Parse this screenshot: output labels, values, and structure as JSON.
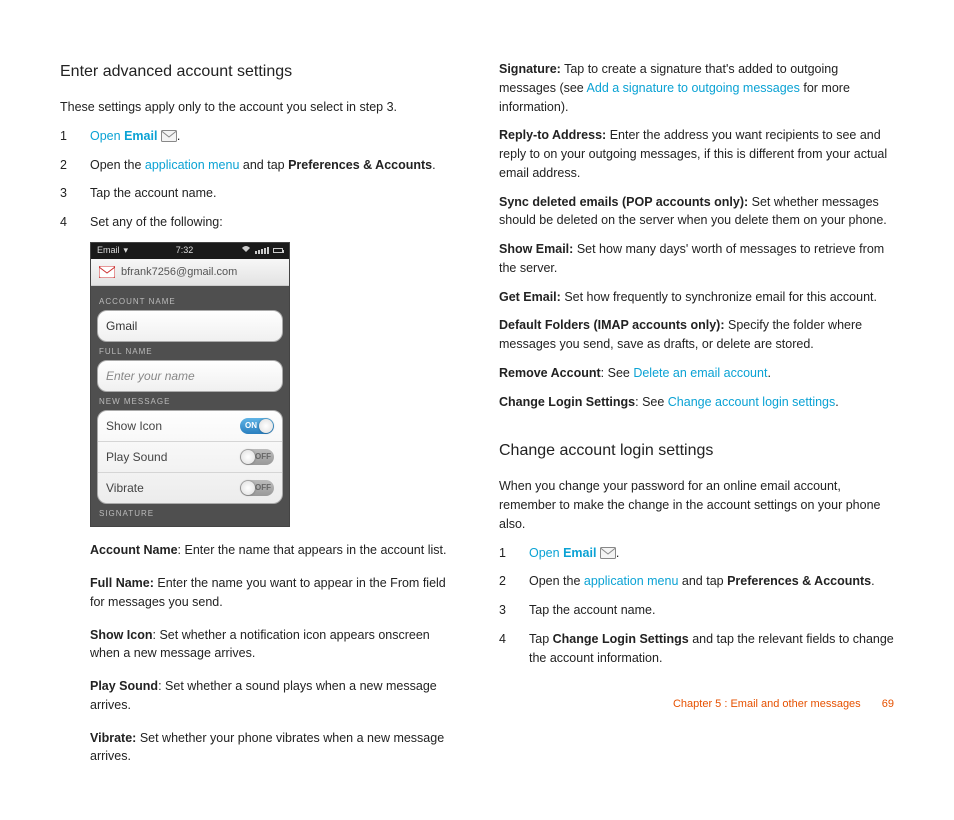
{
  "col1": {
    "heading": "Enter advanced account settings",
    "intro": "These settings apply only to the account you select in step 3.",
    "steps": [
      {
        "num": "1",
        "parts": [
          {
            "t": "link",
            "v": "Open "
          },
          {
            "t": "linkbold",
            "v": "Email"
          },
          {
            "t": "text",
            "v": " "
          },
          {
            "t": "icon"
          },
          {
            "t": "text",
            "v": "."
          }
        ]
      },
      {
        "num": "2",
        "parts": [
          {
            "t": "text",
            "v": "Open the "
          },
          {
            "t": "link",
            "v": "application menu"
          },
          {
            "t": "text",
            "v": " and tap "
          },
          {
            "t": "bold",
            "v": "Preferences & Accounts"
          },
          {
            "t": "text",
            "v": "."
          }
        ]
      },
      {
        "num": "3",
        "parts": [
          {
            "t": "text",
            "v": "Tap the account name."
          }
        ]
      },
      {
        "num": "4",
        "parts": [
          {
            "t": "text",
            "v": "Set any of the following:"
          }
        ]
      }
    ],
    "phone": {
      "status_left": "Email",
      "status_time": "7:32",
      "header_email": "bfrank7256@gmail.com",
      "label_account_name": "ACCOUNT NAME",
      "value_account_name": "Gmail",
      "label_full_name": "FULL NAME",
      "placeholder_full_name": "Enter your name",
      "label_new_message": "NEW MESSAGE",
      "row_show_icon": "Show Icon",
      "row_play_sound": "Play Sound",
      "row_vibrate": "Vibrate",
      "toggle_on": "ON",
      "toggle_off": "OFF",
      "label_signature": "SIGNATURE"
    },
    "defs": [
      {
        "term": "Account Name",
        "sep": ": ",
        "body": "Enter the name that appears in the account list."
      },
      {
        "term": "Full Name:",
        "sep": " ",
        "body": "Enter the name you want to appear in the From field for messages you send."
      },
      {
        "term": "Show Icon",
        "sep": ": ",
        "body": "Set whether a notification icon appears onscreen when a new message arrives."
      },
      {
        "term": "Play Sound",
        "sep": ": ",
        "body": "Set whether a sound plays when a new message arrives."
      },
      {
        "term": "Vibrate:",
        "sep": " ",
        "body": "Set whether your phone vibrates when a new message arrives."
      }
    ]
  },
  "col2": {
    "defs": [
      {
        "term": "Signature:",
        "sep": " ",
        "parts": [
          {
            "t": "text",
            "v": "Tap to create a signature that's added to outgoing messages (see "
          },
          {
            "t": "link",
            "v": "Add a signature to outgoing messages"
          },
          {
            "t": "text",
            "v": " for more information)."
          }
        ]
      },
      {
        "term": "Reply-to Address:",
        "sep": " ",
        "parts": [
          {
            "t": "text",
            "v": "Enter the address you want recipients to see and reply to on your outgoing messages, if this is different from your actual email address."
          }
        ]
      },
      {
        "term": "Sync deleted emails (POP accounts only):",
        "sep": " ",
        "parts": [
          {
            "t": "text",
            "v": "Set whether messages should be deleted on the server when you delete them on your phone."
          }
        ]
      },
      {
        "term": "Show Email:",
        "sep": " ",
        "parts": [
          {
            "t": "text",
            "v": "Set how many days' worth of messages to retrieve from the server."
          }
        ]
      },
      {
        "term": "Get Email:",
        "sep": " ",
        "parts": [
          {
            "t": "text",
            "v": "Set how frequently to synchronize email for this account."
          }
        ]
      },
      {
        "term": "Default Folders (IMAP accounts only):",
        "sep": " ",
        "parts": [
          {
            "t": "text",
            "v": "Specify the folder where messages you send, save as drafts, or delete are stored."
          }
        ]
      },
      {
        "term": "Remove Account",
        "sep": ": ",
        "parts": [
          {
            "t": "text",
            "v": "See "
          },
          {
            "t": "link",
            "v": "Delete an email account"
          },
          {
            "t": "text",
            "v": "."
          }
        ]
      },
      {
        "term": "Change Login Settings",
        "sep": ": ",
        "parts": [
          {
            "t": "text",
            "v": "See "
          },
          {
            "t": "link",
            "v": "Change account login settings"
          },
          {
            "t": "text",
            "v": "."
          }
        ]
      }
    ],
    "heading2": "Change account login settings",
    "intro2": "When you change your password for an online email account, remember to make the change in the account settings on your phone also.",
    "steps2": [
      {
        "num": "1",
        "parts": [
          {
            "t": "link",
            "v": "Open "
          },
          {
            "t": "linkbold",
            "v": "Email"
          },
          {
            "t": "text",
            "v": " "
          },
          {
            "t": "icon"
          },
          {
            "t": "text",
            "v": "."
          }
        ]
      },
      {
        "num": "2",
        "parts": [
          {
            "t": "text",
            "v": "Open the "
          },
          {
            "t": "link",
            "v": "application menu"
          },
          {
            "t": "text",
            "v": " and tap "
          },
          {
            "t": "bold",
            "v": "Preferences & Accounts"
          },
          {
            "t": "text",
            "v": "."
          }
        ]
      },
      {
        "num": "3",
        "parts": [
          {
            "t": "text",
            "v": "Tap the account name."
          }
        ]
      },
      {
        "num": "4",
        "parts": [
          {
            "t": "text",
            "v": "Tap "
          },
          {
            "t": "bold",
            "v": "Change Login Settings"
          },
          {
            "t": "text",
            "v": " and tap the relevant fields to change the account information."
          }
        ]
      }
    ]
  },
  "footer": {
    "chapter": "Chapter 5 : Email and other messages",
    "page": "69"
  }
}
